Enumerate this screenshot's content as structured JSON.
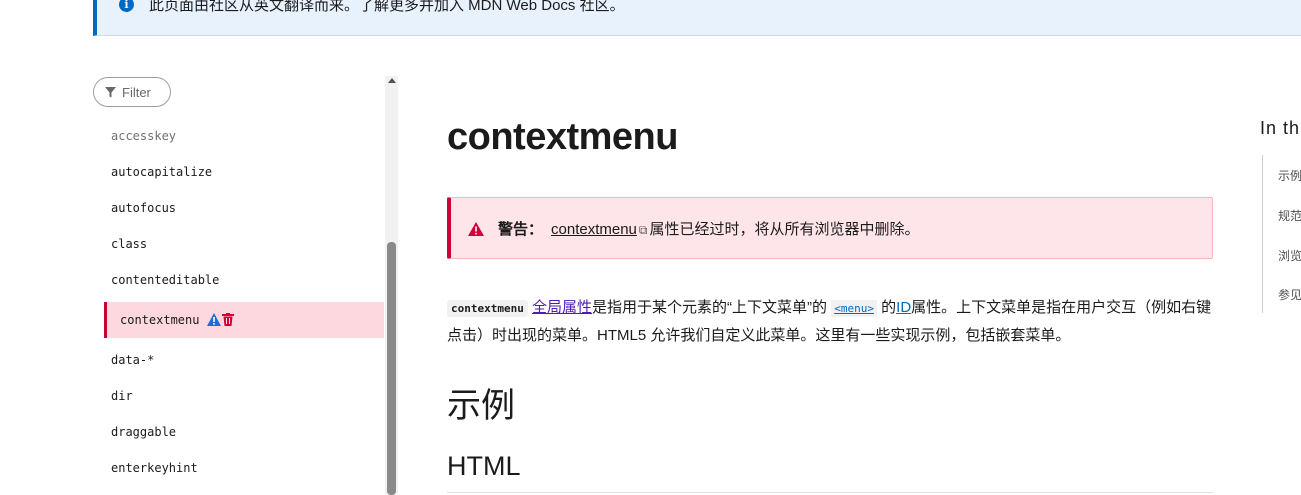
{
  "notice": {
    "text": "此页面由社区从英文翻译而来。了解更多并加入 MDN Web Docs 社区。"
  },
  "sidebar": {
    "filter_placeholder": "Filter",
    "items": [
      "accesskey",
      "autocapitalize",
      "autofocus",
      "class",
      "contenteditable",
      "contextmenu",
      "data-*",
      "dir",
      "draggable",
      "enterkeyhint"
    ],
    "active_item": "contextmenu"
  },
  "main": {
    "title": "contextmenu",
    "warning": {
      "label": "警告：",
      "link": "contextmenu",
      "text": "属性已经过时，将从所有浏览器中删除。"
    },
    "paragraph": {
      "code": "contextmenu",
      "link_global": "全局属性",
      "t1": "是指用于某个元素的“上下文菜单”的",
      "menu_code": "<menu>",
      "t2": "的",
      "link_id": "ID",
      "t3": "属性。上下文菜单是指在用户交互（例如右键点击）时出现的菜单。HTML5 允许我们自定义此菜单。这里有一些实现示例，包括嵌套菜单。"
    },
    "h2": "示例",
    "h3": "HTML"
  },
  "toc": {
    "title": "In th",
    "items": [
      "示例",
      "规范",
      "浏览",
      "参见"
    ]
  },
  "colors": {
    "accent_blue": "#0069c2",
    "warning_red": "#d30038",
    "active_bg": "#fdd8de"
  }
}
